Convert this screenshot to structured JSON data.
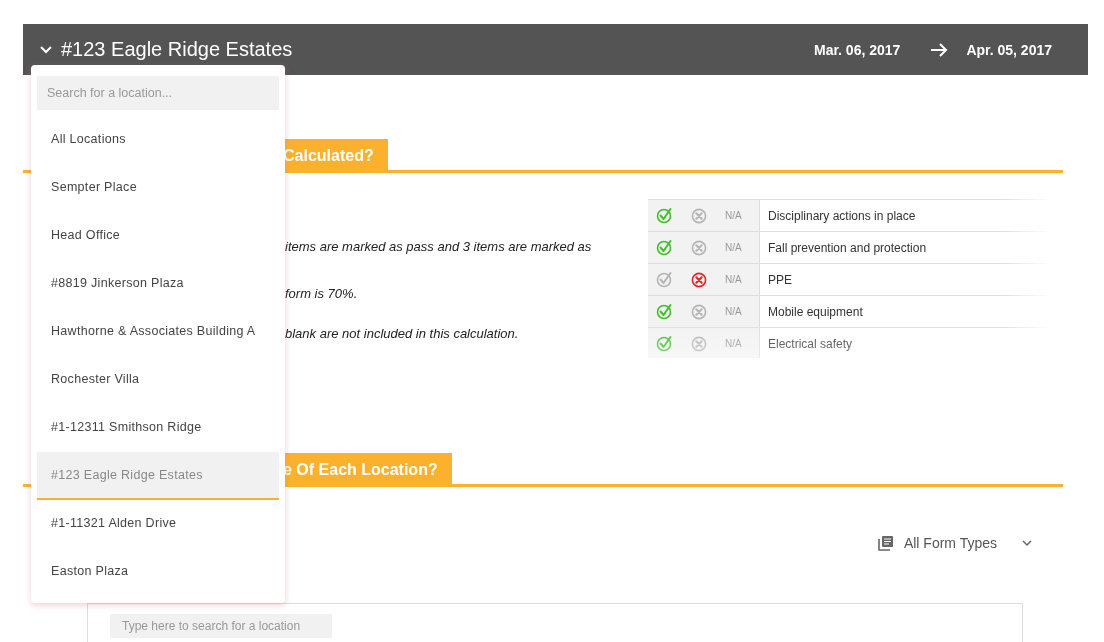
{
  "header": {
    "title": "#123 Eagle Ridge Estates",
    "start_date": "Mar. 06, 2017",
    "end_date": "Apr. 05, 2017"
  },
  "location_menu": {
    "search_placeholder": "Search for a location...",
    "items": [
      {
        "label": "All Locations",
        "selected": false
      },
      {
        "label": "Sempter Place",
        "selected": false
      },
      {
        "label": "Head Office",
        "selected": false
      },
      {
        "label": "#8819 Jinkerson Plaza",
        "selected": false
      },
      {
        "label": "Hawthorne & Associates Building A",
        "selected": false
      },
      {
        "label": "Rochester Villa",
        "selected": false
      },
      {
        "label": "#1-12311 Smithson Ridge",
        "selected": false
      },
      {
        "label": "#123 Eagle Ridge Estates",
        "selected": true
      },
      {
        "label": "#1-11321 Alden Drive",
        "selected": false
      },
      {
        "label": "Easton Plaza",
        "selected": false
      }
    ]
  },
  "score_section": {
    "heading": "Calculated?",
    "paragraphs": [
      "items are marked as pass and 3 items are marked as",
      "form is 70%.",
      "blank are not included in this calculation."
    ],
    "checklist": [
      {
        "label": "Disciplinary actions in place",
        "passed": true,
        "failed": false,
        "na": "N/A"
      },
      {
        "label": "Fall prevention and protection",
        "passed": true,
        "failed": false,
        "na": "N/A"
      },
      {
        "label": "PPE",
        "passed": false,
        "failed": true,
        "na": "N/A"
      },
      {
        "label": "Mobile equipment",
        "passed": true,
        "failed": false,
        "na": "N/A"
      },
      {
        "label": "Electrical safety",
        "passed": true,
        "failed": false,
        "na": "N/A"
      }
    ]
  },
  "location_section": {
    "heading": "e Of Each Location?",
    "filter": {
      "label": "All Form Types"
    },
    "search_placeholder": "Type here to search for a location"
  }
}
